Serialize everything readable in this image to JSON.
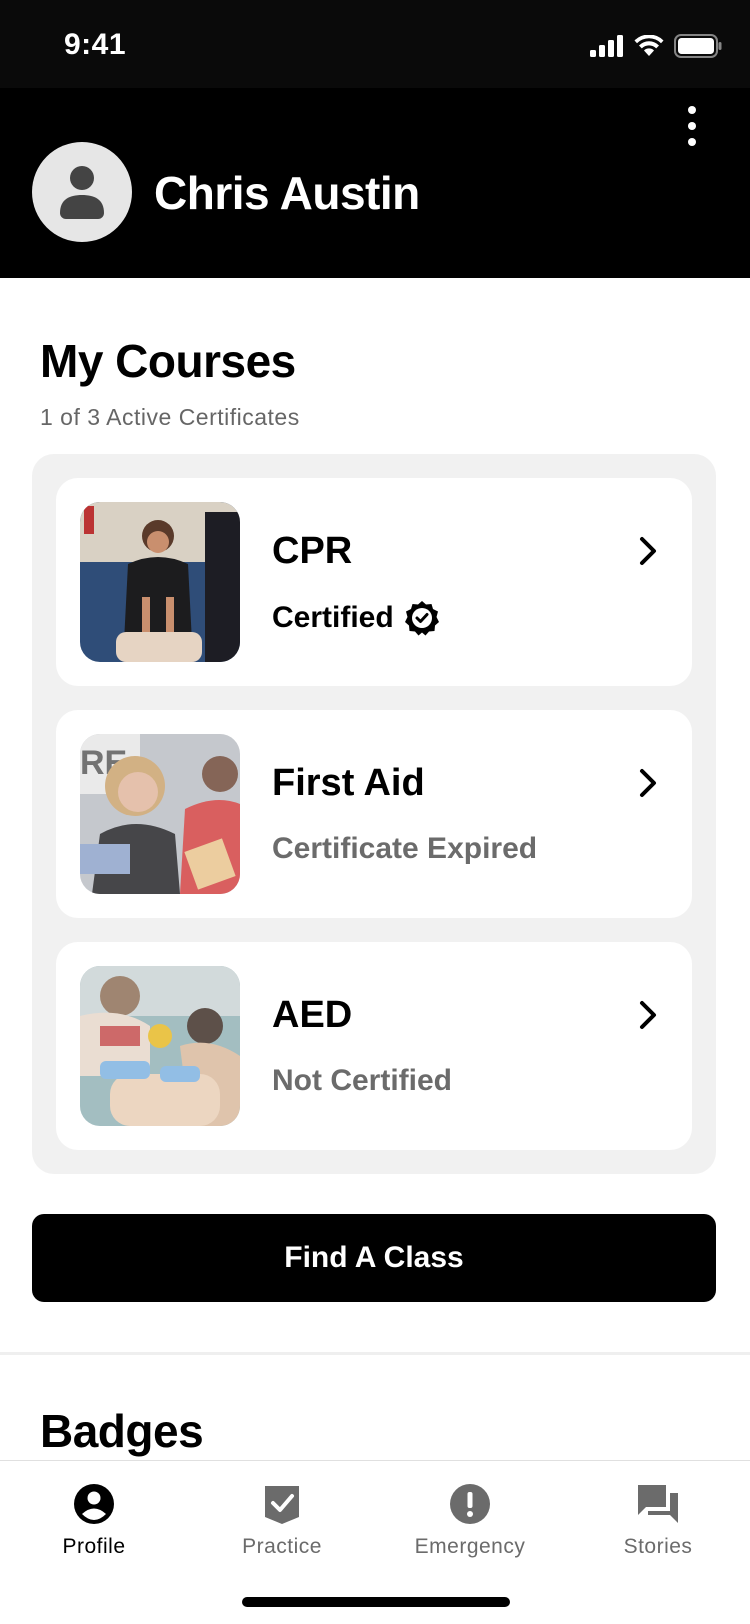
{
  "status_bar": {
    "time": "9:41"
  },
  "header": {
    "user_name": "Chris Austin"
  },
  "courses": {
    "title": "My Courses",
    "subtitle": "1 of 3 Active Certificates",
    "items": [
      {
        "name": "CPR",
        "status": "Certified",
        "certified": true
      },
      {
        "name": "First Aid",
        "status": "Certificate Expired",
        "certified": false
      },
      {
        "name": "AED",
        "status": "Not Certified",
        "certified": false
      }
    ]
  },
  "find_class_label": "Find A Class",
  "badges": {
    "title": "Badges"
  },
  "tabs": [
    {
      "label": "Profile",
      "icon": "profile-icon",
      "active": true
    },
    {
      "label": "Practice",
      "icon": "practice-check-icon",
      "active": false
    },
    {
      "label": "Emergency",
      "icon": "emergency-icon",
      "active": false
    },
    {
      "label": "Stories",
      "icon": "stories-chat-icon",
      "active": false
    }
  ],
  "colors": {
    "header_bg": "#000000",
    "panel_bg": "#f1f1f1",
    "muted_text": "#6b6b6b"
  }
}
